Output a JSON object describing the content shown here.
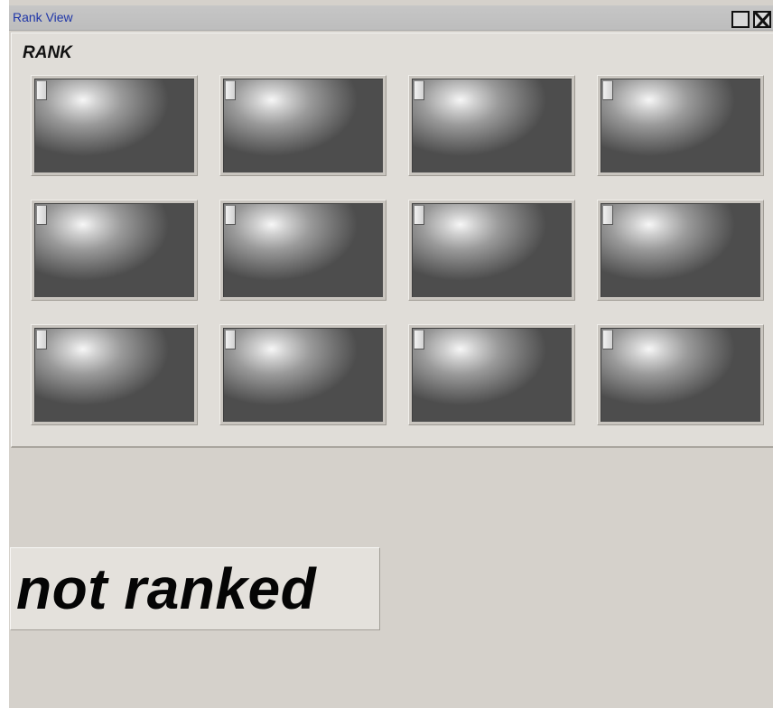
{
  "window": {
    "title": "Rank View"
  },
  "rank_panel": {
    "label": "RANK",
    "tiles": [
      {
        "row": 1,
        "col": 1
      },
      {
        "row": 1,
        "col": 2
      },
      {
        "row": 1,
        "col": 3
      },
      {
        "row": 1,
        "col": 4
      },
      {
        "row": 2,
        "col": 1
      },
      {
        "row": 2,
        "col": 2
      },
      {
        "row": 2,
        "col": 3
      },
      {
        "row": 2,
        "col": 4
      },
      {
        "row": 3,
        "col": 1
      },
      {
        "row": 3,
        "col": 2
      },
      {
        "row": 3,
        "col": 3
      },
      {
        "row": 3,
        "col": 4
      }
    ]
  },
  "status": {
    "text": "not ranked"
  },
  "icons": {
    "maximize": "maximize-icon",
    "close": "close-icon"
  }
}
